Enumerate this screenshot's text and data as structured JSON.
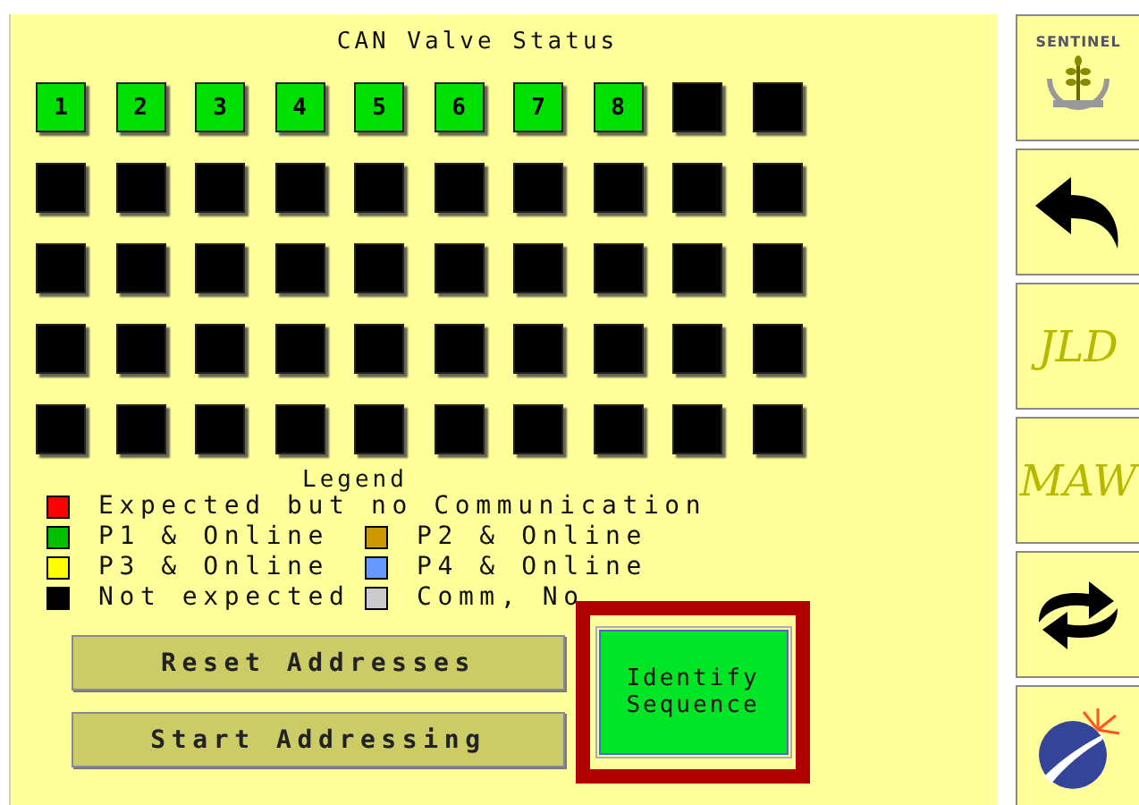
{
  "title": "CAN Valve Status",
  "cells": [
    {
      "label": "1",
      "color": "#00e000"
    },
    {
      "label": "2",
      "color": "#00e000"
    },
    {
      "label": "3",
      "color": "#00e000"
    },
    {
      "label": "4",
      "color": "#00e000"
    },
    {
      "label": "5",
      "color": "#00e000"
    },
    {
      "label": "6",
      "color": "#00e000"
    },
    {
      "label": "7",
      "color": "#00e000"
    },
    {
      "label": "8",
      "color": "#00e000"
    },
    {
      "color": "#000000"
    },
    {
      "color": "#000000"
    },
    {
      "color": "#000000"
    },
    {
      "color": "#000000"
    },
    {
      "color": "#000000"
    },
    {
      "color": "#000000"
    },
    {
      "color": "#000000"
    },
    {
      "color": "#000000"
    },
    {
      "color": "#000000"
    },
    {
      "color": "#000000"
    },
    {
      "color": "#000000"
    },
    {
      "color": "#000000"
    },
    {
      "color": "#000000"
    },
    {
      "color": "#000000"
    },
    {
      "color": "#000000"
    },
    {
      "color": "#000000"
    },
    {
      "color": "#000000"
    },
    {
      "color": "#000000"
    },
    {
      "color": "#000000"
    },
    {
      "color": "#000000"
    },
    {
      "color": "#000000"
    },
    {
      "color": "#000000"
    },
    {
      "color": "#000000"
    },
    {
      "color": "#000000"
    },
    {
      "color": "#000000"
    },
    {
      "color": "#000000"
    },
    {
      "color": "#000000"
    },
    {
      "color": "#000000"
    },
    {
      "color": "#000000"
    },
    {
      "color": "#000000"
    },
    {
      "color": "#000000"
    },
    {
      "color": "#000000"
    },
    {
      "color": "#000000"
    },
    {
      "color": "#000000"
    },
    {
      "color": "#000000"
    },
    {
      "color": "#000000"
    },
    {
      "color": "#000000"
    },
    {
      "color": "#000000"
    },
    {
      "color": "#000000"
    },
    {
      "color": "#000000"
    },
    {
      "color": "#000000"
    },
    {
      "color": "#000000"
    }
  ],
  "legend": {
    "title": "Legend",
    "items": [
      {
        "label": "Expected but no Communication",
        "color": "#ff0000"
      },
      {
        "label": "P1 & Online",
        "color": "#00c000"
      },
      {
        "label": "P2 & Online",
        "color": "#cc9900"
      },
      {
        "label": "P3 & Online",
        "color": "#ffff00"
      },
      {
        "label": "P4 & Online",
        "color": "#6699ff"
      },
      {
        "label": "Not expected",
        "color": "#000000"
      },
      {
        "label": "Comm, No",
        "color": "#cccccc"
      }
    ]
  },
  "buttons": [
    "Reset Addresses",
    "Start Addressing"
  ],
  "identify_button": {
    "label": "Identify Sequence",
    "highlighted": true
  },
  "sidebar": [
    {
      "kind": "logo",
      "text": "SENTINEL"
    },
    {
      "kind": "back"
    },
    {
      "kind": "text",
      "text": "JLD"
    },
    {
      "kind": "text",
      "text": "MAW"
    },
    {
      "kind": "refresh"
    },
    {
      "kind": "globe"
    }
  ]
}
